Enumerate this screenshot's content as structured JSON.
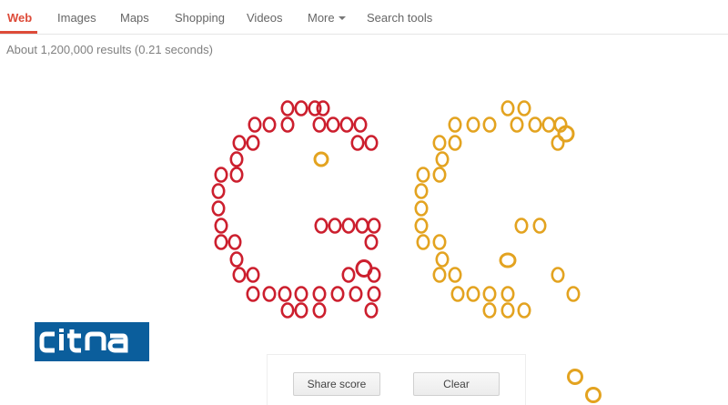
{
  "nav": {
    "tabs": [
      {
        "label": "Web",
        "active": true
      },
      {
        "label": "Images",
        "active": false
      },
      {
        "label": "Maps",
        "active": false
      },
      {
        "label": "Shopping",
        "active": false
      },
      {
        "label": "Videos",
        "active": false
      },
      {
        "label": "More",
        "active": false,
        "icon": "caret-down-icon"
      },
      {
        "label": "Search tools",
        "active": false
      }
    ]
  },
  "results": {
    "stats": "About 1,200,000 results (0.21 seconds)"
  },
  "doodle": {
    "ball_glyph": "O",
    "colors": {
      "red": "#cc1f2e",
      "orange": "#e3a320"
    }
  },
  "watermark": {
    "logo_text": "CITNA",
    "color": "#0b5e9c"
  },
  "controls": {
    "share_label": "Share score",
    "clear_label": "Clear"
  }
}
